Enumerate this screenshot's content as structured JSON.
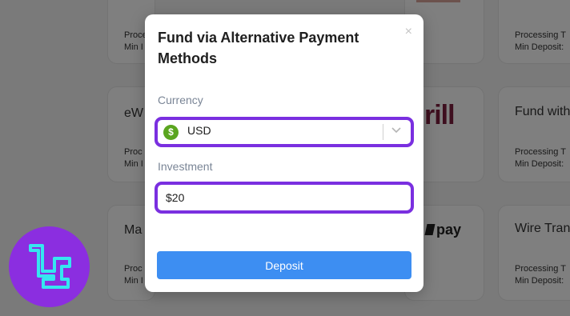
{
  "background": {
    "cards": [
      {
        "name": "",
        "processing": "Processing T",
        "min_deposit": "Min I"
      },
      {
        "name": "eW",
        "processing": "Proc",
        "min_deposit": "Min I"
      },
      {
        "name": "Ma",
        "processing": "Proc",
        "min_deposit": "Min I"
      },
      {
        "name": "",
        "processing": "Processing T",
        "min_deposit": "Min Deposit:"
      },
      {
        "name": "Fund with",
        "processing": "Processing T",
        "min_deposit": "Min Deposit:"
      },
      {
        "name": "Wire Trans",
        "processing": "Processing T",
        "min_deposit": "Min Deposit:"
      }
    ],
    "logos": {
      "skrill_fragment": "rill",
      "pay_fragment": "pay"
    }
  },
  "modal": {
    "title": "Fund via Alternative Payment Methods",
    "currency_label": "Currency",
    "currency_value": "USD",
    "currency_icon": "dollar-coin-icon",
    "currency_symbol": "$",
    "investment_label": "Investment",
    "investment_value": "$20",
    "deposit_label": "Deposit",
    "close_symbol": "×"
  },
  "colors": {
    "accent_border": "#7a2fe0",
    "primary_button": "#3d8ef2",
    "coin_green": "#5aa51f",
    "logo_purple": "#8b2ee0",
    "logo_cyan": "#35e6f0"
  }
}
